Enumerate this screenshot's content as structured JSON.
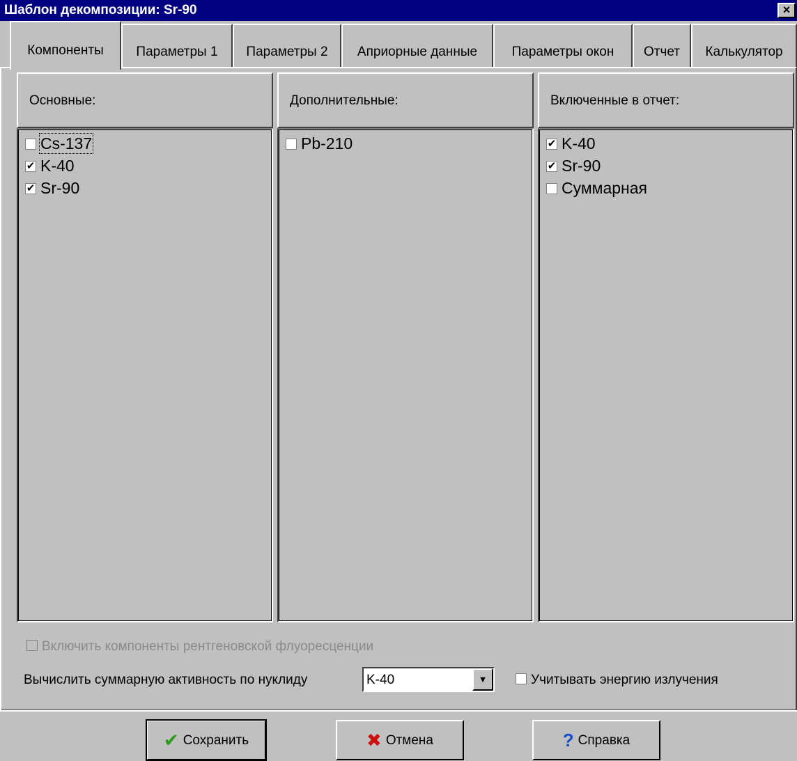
{
  "window": {
    "title": "Шаблон декомпозиции: Sr-90",
    "close_glyph": "×"
  },
  "tabs": [
    {
      "label": "Компоненты",
      "active": true
    },
    {
      "label": "Параметры 1",
      "active": false
    },
    {
      "label": "Параметры 2",
      "active": false
    },
    {
      "label": "Априорные данные",
      "active": false
    },
    {
      "label": "Параметры окон",
      "active": false
    },
    {
      "label": "Отчет",
      "active": false
    },
    {
      "label": "Калькулятор",
      "active": false
    }
  ],
  "columns": {
    "main": {
      "header": "Основные:",
      "items": [
        {
          "label": "Cs-137",
          "checked": false,
          "focused": true
        },
        {
          "label": "K-40",
          "checked": true
        },
        {
          "label": "Sr-90",
          "checked": true
        }
      ]
    },
    "additional": {
      "header": "Дополнительные:",
      "items": [
        {
          "label": "Pb-210",
          "checked": false
        }
      ]
    },
    "report": {
      "header": "Включенные в отчет:",
      "items": [
        {
          "label": "K-40",
          "checked": true
        },
        {
          "label": "Sr-90",
          "checked": true
        },
        {
          "label": "Суммарная",
          "checked": false
        }
      ]
    }
  },
  "options": {
    "xray_label": "Включить компоненты рентгеновской флуоресценции",
    "xray_checked": false,
    "xray_enabled": false,
    "sum_label": "Вычислить суммарную активность по нуклиду",
    "sum_value": "K-40",
    "energy_label": "Учитывать энергию излучения",
    "energy_checked": false
  },
  "buttons": {
    "save_label": "Сохранить",
    "cancel_label": "Отмена",
    "help_label": "Справка"
  },
  "colors": {
    "title_bg": "#000080",
    "save_icon": "#2a9a1a",
    "cancel_icon": "#d01010",
    "help_icon": "#1050c8"
  },
  "icons": {
    "save": "checkmark-icon",
    "cancel": "x-icon",
    "help": "question-icon",
    "dropdown": "dropdown-arrow-icon"
  }
}
